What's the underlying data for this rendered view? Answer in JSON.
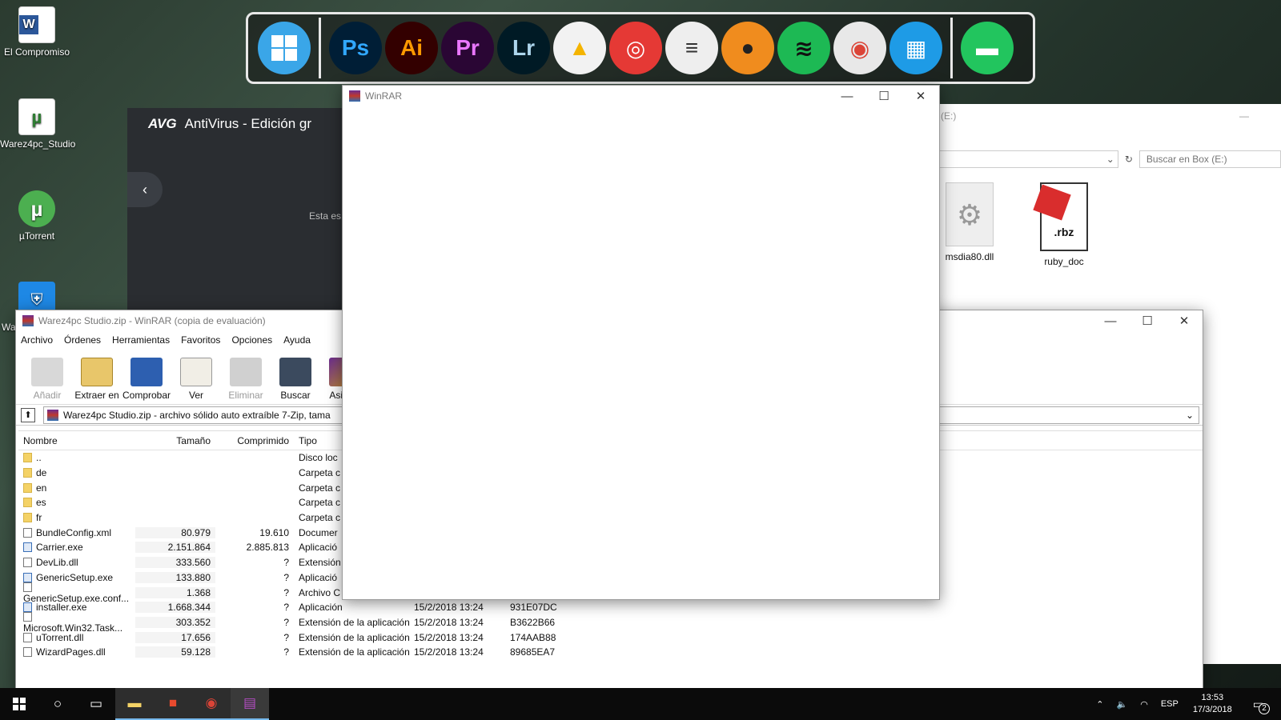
{
  "desktop": {
    "icons": [
      {
        "label": "El Compromiso",
        "icon": "word-doc-icon"
      },
      {
        "label": "Warez4pc_Studio",
        "icon": "torrent-file-icon"
      },
      {
        "label": "µTorrent",
        "icon": "utorrent-icon"
      },
      {
        "label": "Wa",
        "icon": "shield-app-icon"
      }
    ]
  },
  "dock": {
    "apps": [
      {
        "name": "windows",
        "glyph": "",
        "color": "#3aa6e8"
      },
      {
        "name": "photoshop",
        "glyph": "Ps",
        "color": "#001e36"
      },
      {
        "name": "illustrator",
        "glyph": "Ai",
        "color": "#330000"
      },
      {
        "name": "premiere",
        "glyph": "Pr",
        "color": "#2a0634"
      },
      {
        "name": "lightroom",
        "glyph": "Lr",
        "color": "#001a25"
      },
      {
        "name": "drive",
        "glyph": "▲",
        "color": "#f2f2f2"
      },
      {
        "name": "target",
        "glyph": "◎",
        "color": "#e53935"
      },
      {
        "name": "layers",
        "glyph": "≡",
        "color": "#eeeeee"
      },
      {
        "name": "music",
        "glyph": "●",
        "color": "#f08c1e"
      },
      {
        "name": "spotify",
        "glyph": "≋",
        "color": "#1db954"
      },
      {
        "name": "chrome",
        "glyph": "◉",
        "color": "#e8e8e8"
      },
      {
        "name": "store",
        "glyph": "▦",
        "color": "#1e9be6"
      },
      {
        "name": "files",
        "glyph": "▬",
        "color": "#22c55e"
      }
    ]
  },
  "avg": {
    "title": "AntiVirus - Edición gr",
    "logo": "AVG",
    "partial_text": "Esta es"
  },
  "explorer": {
    "title": "Box (E:)",
    "search_placeholder": "Buscar en Box (E:)",
    "files": [
      {
        "name": "msdia80.dll"
      },
      {
        "name": "ruby_doc"
      }
    ]
  },
  "winrar_empty": {
    "title": "WinRAR"
  },
  "winrar": {
    "title": "Warez4pc Studio.zip - WinRAR (copia de evaluación)",
    "menu": [
      "Archivo",
      "Órdenes",
      "Herramientas",
      "Favoritos",
      "Opciones",
      "Ayuda"
    ],
    "toolbar": [
      {
        "label": "Añadir",
        "enabled": false
      },
      {
        "label": "Extraer en",
        "enabled": true
      },
      {
        "label": "Comprobar",
        "enabled": true
      },
      {
        "label": "Ver",
        "enabled": true
      },
      {
        "label": "Eliminar",
        "enabled": false
      },
      {
        "label": "Buscar",
        "enabled": true
      },
      {
        "label": "Asisten",
        "enabled": true
      }
    ],
    "path": "Warez4pc Studio.zip - archivo sólido auto extraíble 7-Zip, tama",
    "columns": {
      "name": "Nombre",
      "size": "Tamaño",
      "packed": "Comprimido",
      "type": "Tipo"
    },
    "rows": [
      {
        "name": "..",
        "size": "",
        "packed": "",
        "type": "Disco loc",
        "date": "",
        "crc": "",
        "kind": "up"
      },
      {
        "name": "de",
        "size": "",
        "packed": "",
        "type": "Carpeta c",
        "date": "",
        "crc": "",
        "kind": "folder"
      },
      {
        "name": "en",
        "size": "",
        "packed": "",
        "type": "Carpeta c",
        "date": "",
        "crc": "",
        "kind": "folder"
      },
      {
        "name": "es",
        "size": "",
        "packed": "",
        "type": "Carpeta c",
        "date": "",
        "crc": "",
        "kind": "folder"
      },
      {
        "name": "fr",
        "size": "",
        "packed": "",
        "type": "Carpeta c",
        "date": "",
        "crc": "",
        "kind": "folder"
      },
      {
        "name": "BundleConfig.xml",
        "size": "80.979",
        "packed": "19.610",
        "type": "Documer",
        "date": "",
        "crc": "",
        "kind": "file"
      },
      {
        "name": "Carrier.exe",
        "size": "2.151.864",
        "packed": "2.885.813",
        "type": "Aplicació",
        "date": "",
        "crc": "",
        "kind": "exe"
      },
      {
        "name": "DevLib.dll",
        "size": "333.560",
        "packed": "?",
        "type": "Extensión",
        "date": "",
        "crc": "",
        "kind": "file"
      },
      {
        "name": "GenericSetup.exe",
        "size": "133.880",
        "packed": "?",
        "type": "Aplicació",
        "date": "",
        "crc": "",
        "kind": "exe"
      },
      {
        "name": "GenericSetup.exe.conf...",
        "size": "1.368",
        "packed": "?",
        "type": "Archivo C",
        "date": "",
        "crc": "",
        "kind": "file"
      },
      {
        "name": "installer.exe",
        "size": "1.668.344",
        "packed": "?",
        "type": "Aplicación",
        "date": "15/2/2018 13:24",
        "crc": "931E07DC",
        "kind": "exe"
      },
      {
        "name": "Microsoft.Win32.Task...",
        "size": "303.352",
        "packed": "?",
        "type": "Extensión de la aplicación",
        "date": "15/2/2018 13:24",
        "crc": "B3622B66",
        "kind": "file"
      },
      {
        "name": "uTorrent.dll",
        "size": "17.656",
        "packed": "?",
        "type": "Extensión de la aplicación",
        "date": "15/2/2018 13:24",
        "crc": "174AAB88",
        "kind": "file"
      },
      {
        "name": "WizardPages.dll",
        "size": "59.128",
        "packed": "?",
        "type": "Extensión de la aplicación",
        "date": "15/2/2018 13:24",
        "crc": "89685EA7",
        "kind": "file"
      }
    ]
  },
  "taskbar": {
    "language": "ESP",
    "time": "13:53",
    "date": "17/3/2018",
    "notifications": "2",
    "accent": "#76b9ed"
  }
}
